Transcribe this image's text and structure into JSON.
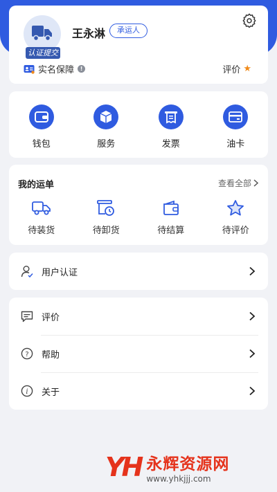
{
  "profile": {
    "name": "王永淋",
    "role": "承运人",
    "verify_tag": "认证提交",
    "realname_label": "实名保障",
    "rating_label": "评价"
  },
  "quick": {
    "items": [
      {
        "label": "钱包",
        "icon": "wallet-icon"
      },
      {
        "label": "服务",
        "icon": "box-icon"
      },
      {
        "label": "发票",
        "icon": "invoice-icon"
      },
      {
        "label": "油卡",
        "icon": "card-icon"
      }
    ]
  },
  "orders": {
    "title": "我的运单",
    "view_all": "查看全部",
    "items": [
      {
        "label": "待装货",
        "icon": "truck-icon"
      },
      {
        "label": "待卸货",
        "icon": "unload-clock-icon"
      },
      {
        "label": "待结算",
        "icon": "wallet-outline-icon"
      },
      {
        "label": "待评价",
        "icon": "star-outline-icon"
      }
    ]
  },
  "cert": {
    "label": "用户认证"
  },
  "menu": {
    "items": [
      {
        "label": "评价",
        "icon": "comment-icon"
      },
      {
        "label": "帮助",
        "icon": "help-icon"
      },
      {
        "label": "关于",
        "icon": "info-icon"
      }
    ]
  },
  "watermark": {
    "name": "永辉资源网",
    "url": "www.yhkjjj.com",
    "logo": "YH"
  },
  "colors": {
    "accent": "#2f5be0",
    "star": "#f08a1a",
    "background": "#f1f2f6",
    "watermark": "#e5331c"
  }
}
